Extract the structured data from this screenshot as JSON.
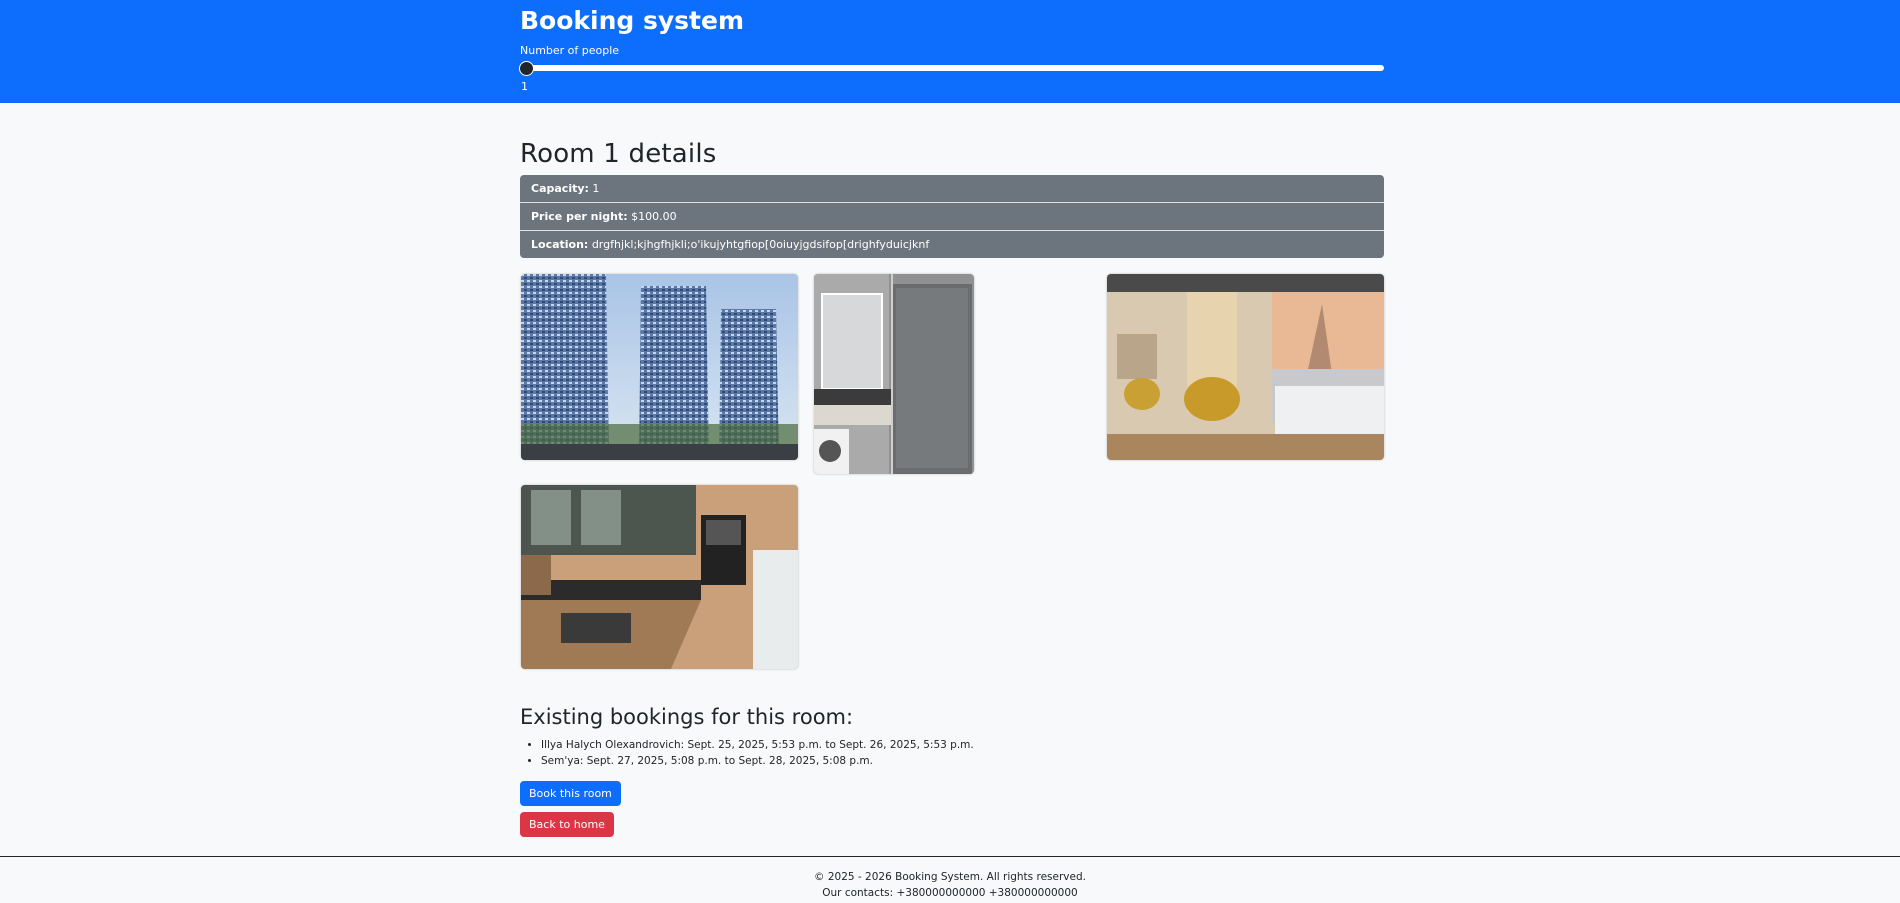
{
  "header": {
    "title": "Booking system",
    "slider_label": "Number of people",
    "slider_value": "1",
    "slider_fraction": 0
  },
  "room": {
    "title": "Room 1 details",
    "details": [
      {
        "label": "Capacity:",
        "value": "1"
      },
      {
        "label": "Price per night:",
        "value": "$100.00"
      },
      {
        "label": "Location:",
        "value": "drgfhjkl;kjhgfhjkli;o'ikujyhtgfiop[0oiuyjgdsifop[drighfyduicjknf"
      }
    ]
  },
  "gallery": {
    "photos": [
      "building-exterior-photo",
      "bathroom-photo",
      "bedroom-photo",
      "kitchen-photo"
    ]
  },
  "bookings": {
    "title": "Existing bookings for this room:",
    "items": [
      "Illya Halych Olexandrovich: Sept. 25, 2025, 5:53 p.m. to Sept. 26, 2025, 5:53 p.m.",
      "Sem'ya: Sept. 27, 2025, 5:08 p.m. to Sept. 28, 2025, 5:08 p.m."
    ]
  },
  "actions": {
    "book_label": "Book this room",
    "back_label": "Back to home"
  },
  "footer": {
    "copyright": "© 2025 - 2026 Booking System. All rights reserved.",
    "contacts": "Our contacts: +380000000000 +380000000000"
  },
  "colors": {
    "primary": "#0d6efd",
    "danger": "#dc3545",
    "secondary": "#6c757d",
    "background": "#f8f9fa"
  }
}
